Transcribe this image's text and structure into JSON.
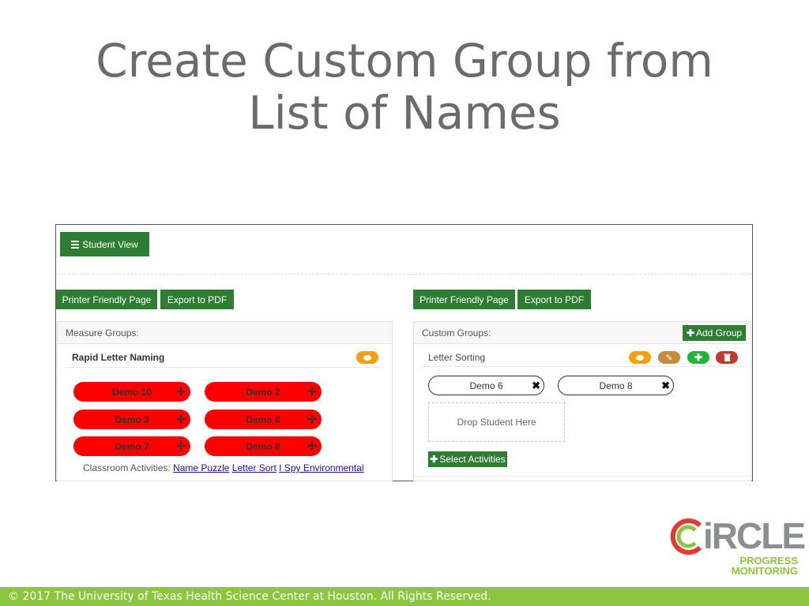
{
  "slide": {
    "title_line1": "Create Custom Group from",
    "title_line2": "List of Names"
  },
  "topbar": {
    "student_view_label": "Student View"
  },
  "left_toolbar": {
    "printer_label": "Printer Friendly Page",
    "export_label": "Export to PDF"
  },
  "right_toolbar": {
    "printer_label": "Printer Friendly Page",
    "export_label": "Export to PDF"
  },
  "measure_groups": {
    "header": "Measure Groups:",
    "group_name": "Rapid Letter Naming",
    "students": [
      "Demo 10",
      "Demo 2",
      "Demo 3",
      "Demo 6",
      "Demo 7",
      "Demo 8"
    ],
    "activities_label": "Classroom Activities:",
    "activities": [
      "Name Puzzle",
      "Letter Sort",
      "I Spy Environmental"
    ]
  },
  "custom_groups": {
    "header": "Custom Groups:",
    "add_group_label": "Add Group",
    "group_name": "Letter Sorting",
    "students": [
      "Demo 6",
      "Demo 8"
    ],
    "drop_placeholder": "Drop Student Here",
    "select_activities_label": "Select Activities"
  },
  "icons": {
    "comment": "comment-icon",
    "edit": "pencil-icon",
    "add": "plus-icon",
    "delete": "trash-icon",
    "move": "move-icon",
    "remove": "close-icon",
    "list": "list-icon"
  },
  "colors": {
    "primary_green": "#2e7d32",
    "chip_red": "#ff0000",
    "comment_orange": "#f5a00a",
    "edit_brown": "#c68a3c",
    "add_green": "#23b33a",
    "delete_red": "#c0392b",
    "footer_green": "#8cc63f"
  },
  "logo": {
    "word": "CiRCLE",
    "line1": "PROGRESS",
    "line2": "MONITORING"
  },
  "footer": {
    "text": "© 2017 The University of Texas Health Science Center at Houston. All Rights Reserved."
  }
}
